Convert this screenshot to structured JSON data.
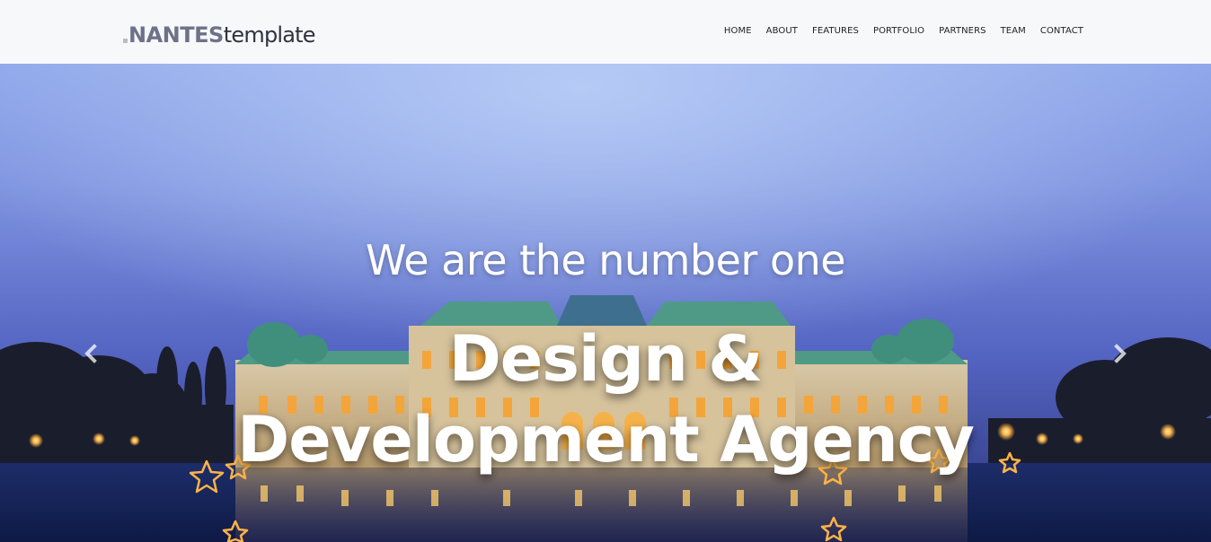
{
  "brand": {
    "bold": "NANTES",
    "light": "template"
  },
  "nav": {
    "items": [
      "HOME",
      "ABOUT",
      "FEATURES",
      "PORTFOLIO",
      "PARTNERS",
      "TEAM",
      "CONTACT"
    ]
  },
  "hero": {
    "subtitle": "We are the number one",
    "title_line1": "Design &",
    "title_line2": "Development Agency",
    "prev_icon": "chevron-left-icon",
    "next_icon": "chevron-right-icon"
  },
  "colors": {
    "header_bg": "#f7f8fa",
    "logo_bold": "#6d7289",
    "sky_top": "#a9bff2",
    "sky_bottom": "#3c4fa8",
    "light_glow": "#ffb347"
  }
}
